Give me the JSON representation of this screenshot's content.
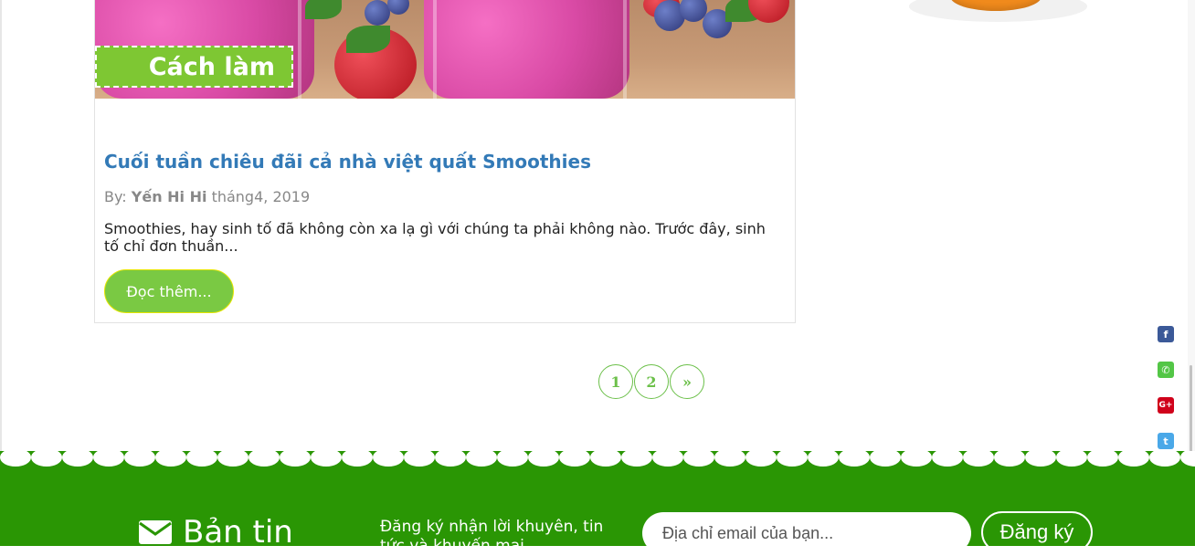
{
  "post": {
    "image_tag": "Cách làm",
    "title": "Cuối tuần chiêu đãi cả nhà việt quất Smoothies",
    "meta": {
      "by_label": "By: ",
      "author": "Yến Hi Hi",
      "date": " tháng4, 2019"
    },
    "excerpt": "Smoothies, hay sinh tố đã không còn xa lạ gì với chúng ta phải không nào. Trước đây, sinh tố chỉ đơn thuần...",
    "read_more_label": "Đọc thêm..."
  },
  "pagination": {
    "pages": [
      "1",
      "2"
    ],
    "next_label": "»"
  },
  "social": [
    {
      "icon": "facebook-icon",
      "glyph": "f"
    },
    {
      "icon": "phone-icon",
      "glyph": "✆"
    },
    {
      "icon": "google-plus-icon",
      "glyph": "G+"
    },
    {
      "icon": "twitter-icon",
      "glyph": "t"
    }
  ],
  "footer": {
    "newsletter_title": "Bản tin",
    "newsletter_desc": "Đăng ký nhận lời khuyên, tin tức và khuyến mại",
    "email_placeholder": "Địa chỉ email của bạn...",
    "subscribe_label": "Đăng ký"
  },
  "colors": {
    "title_blue": "#337ab7",
    "accent_green": "#7ac943",
    "footer_green": "#2a9604",
    "pagination_green": "#6cc04a"
  }
}
